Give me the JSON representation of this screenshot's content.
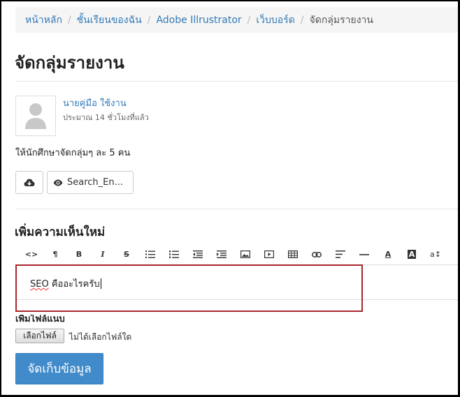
{
  "breadcrumb": {
    "items": [
      "หน้าหลัก",
      "ชั้นเรียนของฉัน",
      "Adobe Illrustrator",
      "เว็บบอร์ด"
    ],
    "current": "จัดกลุ่มรายงาน"
  },
  "page": {
    "title": "จัดกลุ่มรายงาน"
  },
  "post": {
    "author": "นายคู่มือ ใช้งาน",
    "time": "ประมาณ 14 ชั่วโมงที่แล้ว",
    "body": "ให้นักศึกษาจัดกลุ่มๆ ละ 5 คน",
    "attachment_label": "Search_En..."
  },
  "comment": {
    "section_title": "เพิ่มความเห็นใหม่",
    "editor_text_misspelled": "SEO",
    "editor_text_rest": " คืออะไรครับ",
    "attach_label": "เพิ่มไฟล์แนบ",
    "file_button": "เลือกไฟล์",
    "file_status": "ไม่ได้เลือกไฟล์ใด",
    "submit_label": "จัดเก็บข้อมูล"
  },
  "toolbar": {
    "buttons": [
      "code-view",
      "paragraph",
      "bold",
      "italic",
      "strikethrough",
      "bulleted-list",
      "numbered-list",
      "outdent",
      "indent",
      "image",
      "video",
      "table",
      "link",
      "align",
      "horizontal-rule",
      "text-color",
      "background-color",
      "font-size"
    ],
    "labels": {
      "bold": "B",
      "italic": "I",
      "text-color": "A",
      "bg-color": "A",
      "paragraph": "¶",
      "code": "<>",
      "font-size": "a↕",
      "strike": "S"
    }
  },
  "colors": {
    "link": "#337ab7",
    "primary": "#428bca",
    "highlight": "#a8262e"
  }
}
